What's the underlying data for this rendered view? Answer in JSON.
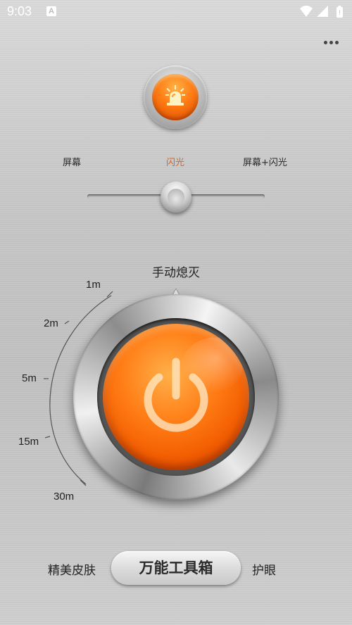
{
  "status_bar": {
    "time": "9:03",
    "notification_badge": "A",
    "icons": [
      "wifi-icon",
      "signal-icon",
      "battery-icon"
    ]
  },
  "header": {
    "more_icon": "more-icon"
  },
  "alarm": {
    "icon": "alarm-light-icon"
  },
  "modes": {
    "items": [
      {
        "label": "屏幕",
        "active": false
      },
      {
        "label": "闪光",
        "active": true
      },
      {
        "label": "屏幕+闪光",
        "active": false
      }
    ],
    "selected": "闪光",
    "active_color": "#e0621a"
  },
  "timer": {
    "title": "手动熄灭",
    "options": [
      "1m",
      "2m",
      "5m",
      "15m",
      "30m"
    ]
  },
  "power": {
    "icon": "power-icon",
    "color": "#ff7b14"
  },
  "bottom": {
    "left_label": "精美皮肤",
    "center_label": "万能工具箱",
    "right_label": "护眼"
  }
}
